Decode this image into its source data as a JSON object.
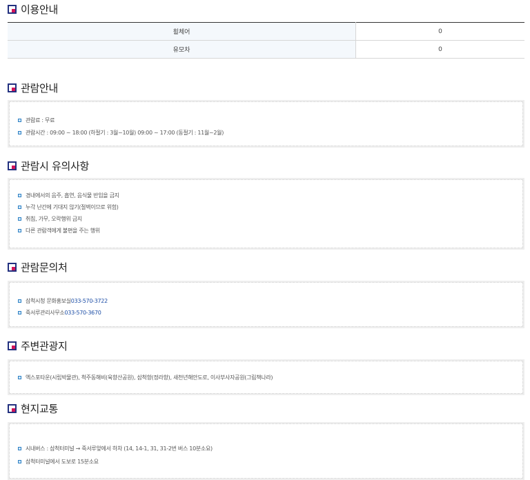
{
  "usage": {
    "title": "이용안내",
    "rows": [
      {
        "label": "휠체어",
        "value": "0"
      },
      {
        "label": "유모차",
        "value": "0"
      }
    ]
  },
  "viewing": {
    "title": "관람안내",
    "items": [
      "관람료 : 무료",
      "관람시간 : 09:00 ~ 18:00 (하절기 : 3월~10월) 09:00 ~ 17:00 (동절기 : 11월~2월)"
    ]
  },
  "notice": {
    "title": "관람시 유의사항",
    "items": [
      "경내에서의 음주, 흡연, 음식물 반입을 금지",
      "누각 난간에 기대지 않기(절벽이므로 위험)",
      "취침, 가무, 오락행위 금지",
      "다른 관람객에게 불편을 주는 행위"
    ]
  },
  "contact": {
    "title": "관람문의처",
    "items": [
      {
        "label": "삼척시청 문화홍보실 ",
        "phone": "033-570-3722"
      },
      {
        "label": "죽서루관리사무소 ",
        "phone": "033-570-3670"
      }
    ]
  },
  "nearby": {
    "title": "주변관광지",
    "items": [
      "엑스포타운(시립박물관), 척주동해비(육향산공원), 삼척항(정라항), 새천년해안도로, 이사부사자공원(그림책나라)"
    ]
  },
  "transport": {
    "title": "현지교통",
    "items": [
      "시내버스 : 삼척터미널 → 죽서루앞에서 하차 (14, 14-1, 31, 31-2번 버스 10분소요)",
      "삼척터미널에서 도보로 15분소요"
    ]
  }
}
